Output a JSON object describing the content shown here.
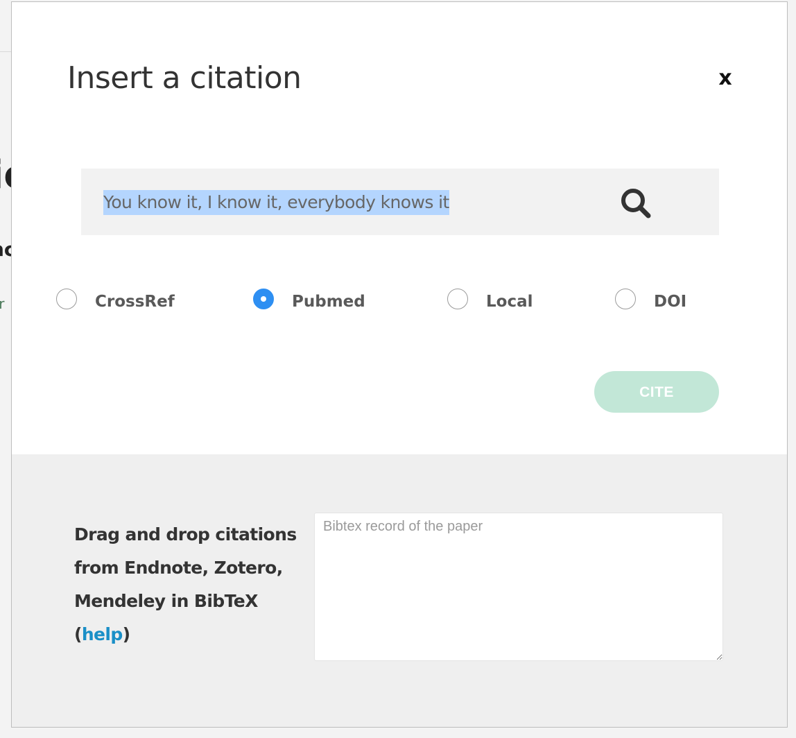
{
  "modal": {
    "title": "Insert a citation",
    "close_label": "x"
  },
  "search": {
    "value": "You know it, I know it, everybody knows it",
    "icon": "search-icon"
  },
  "sources": {
    "options": [
      {
        "label": "CrossRef",
        "checked": false
      },
      {
        "label": "Pubmed",
        "checked": true
      },
      {
        "label": "Local",
        "checked": false
      },
      {
        "label": "DOI",
        "checked": false
      }
    ],
    "selected": "Pubmed"
  },
  "cite_button": {
    "label": "CITE",
    "enabled": false
  },
  "bibtex": {
    "instructions_line1": "Drag and drop citations from Endnote, Zotero, Mendeley in BibTeX",
    "open_paren": "(",
    "help_label": "help",
    "close_paren": ")",
    "placeholder": "Bibtex record of the paper"
  },
  "colors": {
    "accent": "#2e8ff2",
    "cite_disabled": "#c2e7d7",
    "link": "#1a8fc7",
    "selection": "#b4d5fe"
  }
}
